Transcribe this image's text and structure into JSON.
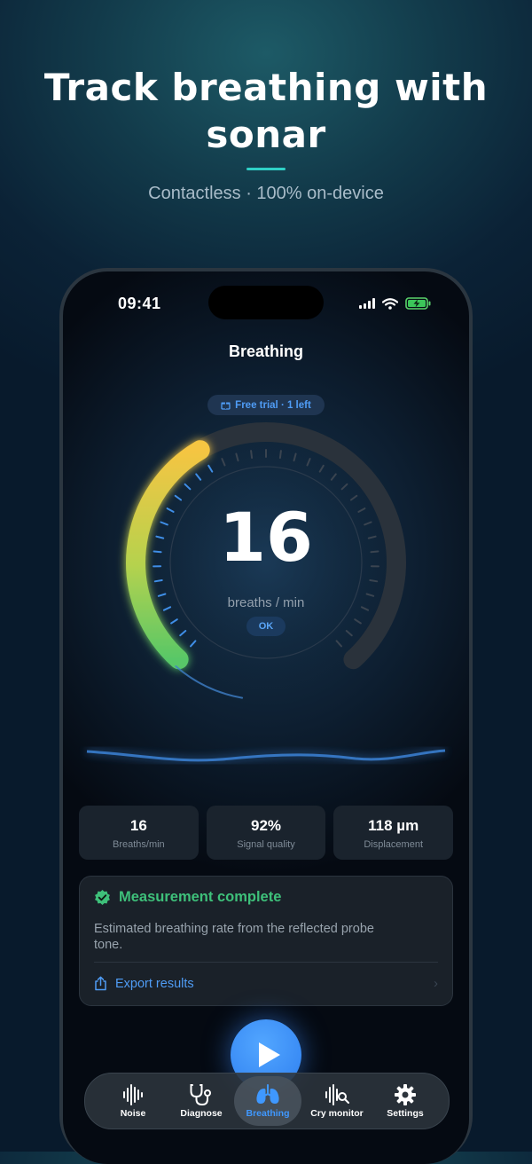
{
  "hero": {
    "title_line1": "Track breathing with",
    "title_line2": "sonar",
    "subtitle": "Contactless · 100% on-device",
    "accent_color": "#2fd0c6"
  },
  "status_bar": {
    "time": "09:41",
    "icons": [
      "cellular-signal-icon",
      "wifi-icon",
      "battery-charging-icon"
    ]
  },
  "screen": {
    "title": "Breathing",
    "trial_badge": "Free trial · 1 left",
    "gauge": {
      "value": "16",
      "unit": "breaths / min",
      "status": "OK",
      "fill_fraction": 0.39,
      "gradient_colors": [
        "#f5c542",
        "#58c767"
      ]
    }
  },
  "stats": [
    {
      "value": "16",
      "label": "Breaths/min"
    },
    {
      "value": "92%",
      "label": "Signal quality"
    },
    {
      "value": "118 µm",
      "label": "Displacement"
    }
  ],
  "result_card": {
    "title": "Measurement complete",
    "description": "Estimated breathing rate from the reflected probe tone.",
    "export_label": "Export results",
    "success_color": "#3ec07a"
  },
  "tabs": [
    {
      "label": "Noise",
      "icon": "waveform-icon",
      "active": false
    },
    {
      "label": "Diagnose",
      "icon": "stethoscope-icon",
      "active": false
    },
    {
      "label": "Breathing",
      "icon": "lungs-icon",
      "active": true
    },
    {
      "label": "Cry monitor",
      "icon": "wave-search-icon",
      "active": false
    },
    {
      "label": "Settings",
      "icon": "gear-icon",
      "active": false
    }
  ],
  "accent_blue": "#3f98ff"
}
